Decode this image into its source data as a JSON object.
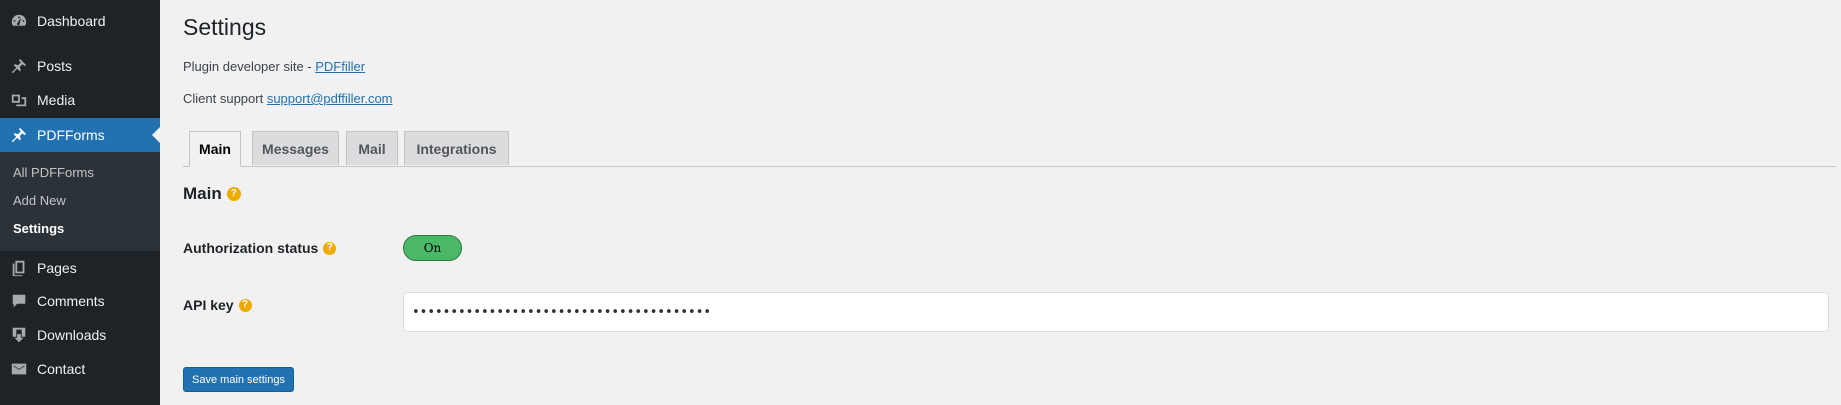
{
  "sidebar": {
    "items": [
      {
        "label": "Dashboard",
        "icon": "dashboard-icon"
      },
      {
        "label": "Posts",
        "icon": "pin-icon"
      },
      {
        "label": "Media",
        "icon": "media-icon"
      },
      {
        "label": "PDFForms",
        "icon": "pin-icon"
      },
      {
        "label": "Pages",
        "icon": "pages-icon"
      },
      {
        "label": "Comments",
        "icon": "comment-icon"
      },
      {
        "label": "Downloads",
        "icon": "download-icon"
      },
      {
        "label": "Contact",
        "icon": "mail-icon"
      }
    ],
    "submenu": [
      "All PDFForms",
      "Add New",
      "Settings"
    ]
  },
  "page": {
    "title": "Settings",
    "developer_prefix": "Plugin developer site - ",
    "developer_link": "PDFfiller",
    "support_prefix": "Client support ",
    "support_link": "support@pdffiller.com"
  },
  "tabs": [
    "Main",
    "Messages",
    "Mail",
    "Integrations"
  ],
  "section": {
    "title": "Main",
    "auth_label": "Authorization status",
    "toggle_label": "On",
    "api_label": "API key",
    "api_value": "•••••••••••••••••••••••••••••••••••••••",
    "save_label": "Save main settings"
  },
  "colors": {
    "sidebar_bg": "#1d2327",
    "accent": "#2271b1",
    "toggle_on": "#4ab866",
    "help_icon": "#f0ab00"
  }
}
